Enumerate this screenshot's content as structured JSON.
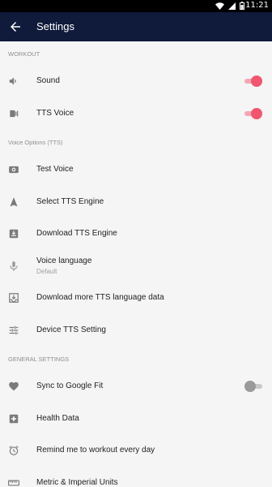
{
  "status_bar": {
    "time": "11:21"
  },
  "app_bar": {
    "title": "Settings"
  },
  "sections": {
    "workout": "WORKOUT",
    "voice_options": "Voice Options (TTS)",
    "general": "GENERAL SETTINGS"
  },
  "rows": {
    "sound": {
      "label": "Sound",
      "toggle": true
    },
    "tts_voice": {
      "label": "TTS Voice",
      "toggle": true
    },
    "test_voice": {
      "label": "Test Voice"
    },
    "select_engine": {
      "label": "Select TTS Engine"
    },
    "download_engine": {
      "label": "Download TTS Engine"
    },
    "voice_language": {
      "label": "Voice language",
      "value": "Default"
    },
    "download_language": {
      "label": "Download more TTS language data"
    },
    "device_setting": {
      "label": "Device TTS Setting"
    },
    "google_fit": {
      "label": "Sync to Google Fit",
      "toggle": false
    },
    "health_data": {
      "label": "Health Data"
    },
    "remind": {
      "label": "Remind me to workout every day"
    },
    "units": {
      "label": "Metric & Imperial Units"
    }
  },
  "colors": {
    "app_bar": "#101a3a",
    "accent": "#f0566f",
    "icon": "#7a7a7a",
    "background": "#f5f5f5"
  }
}
